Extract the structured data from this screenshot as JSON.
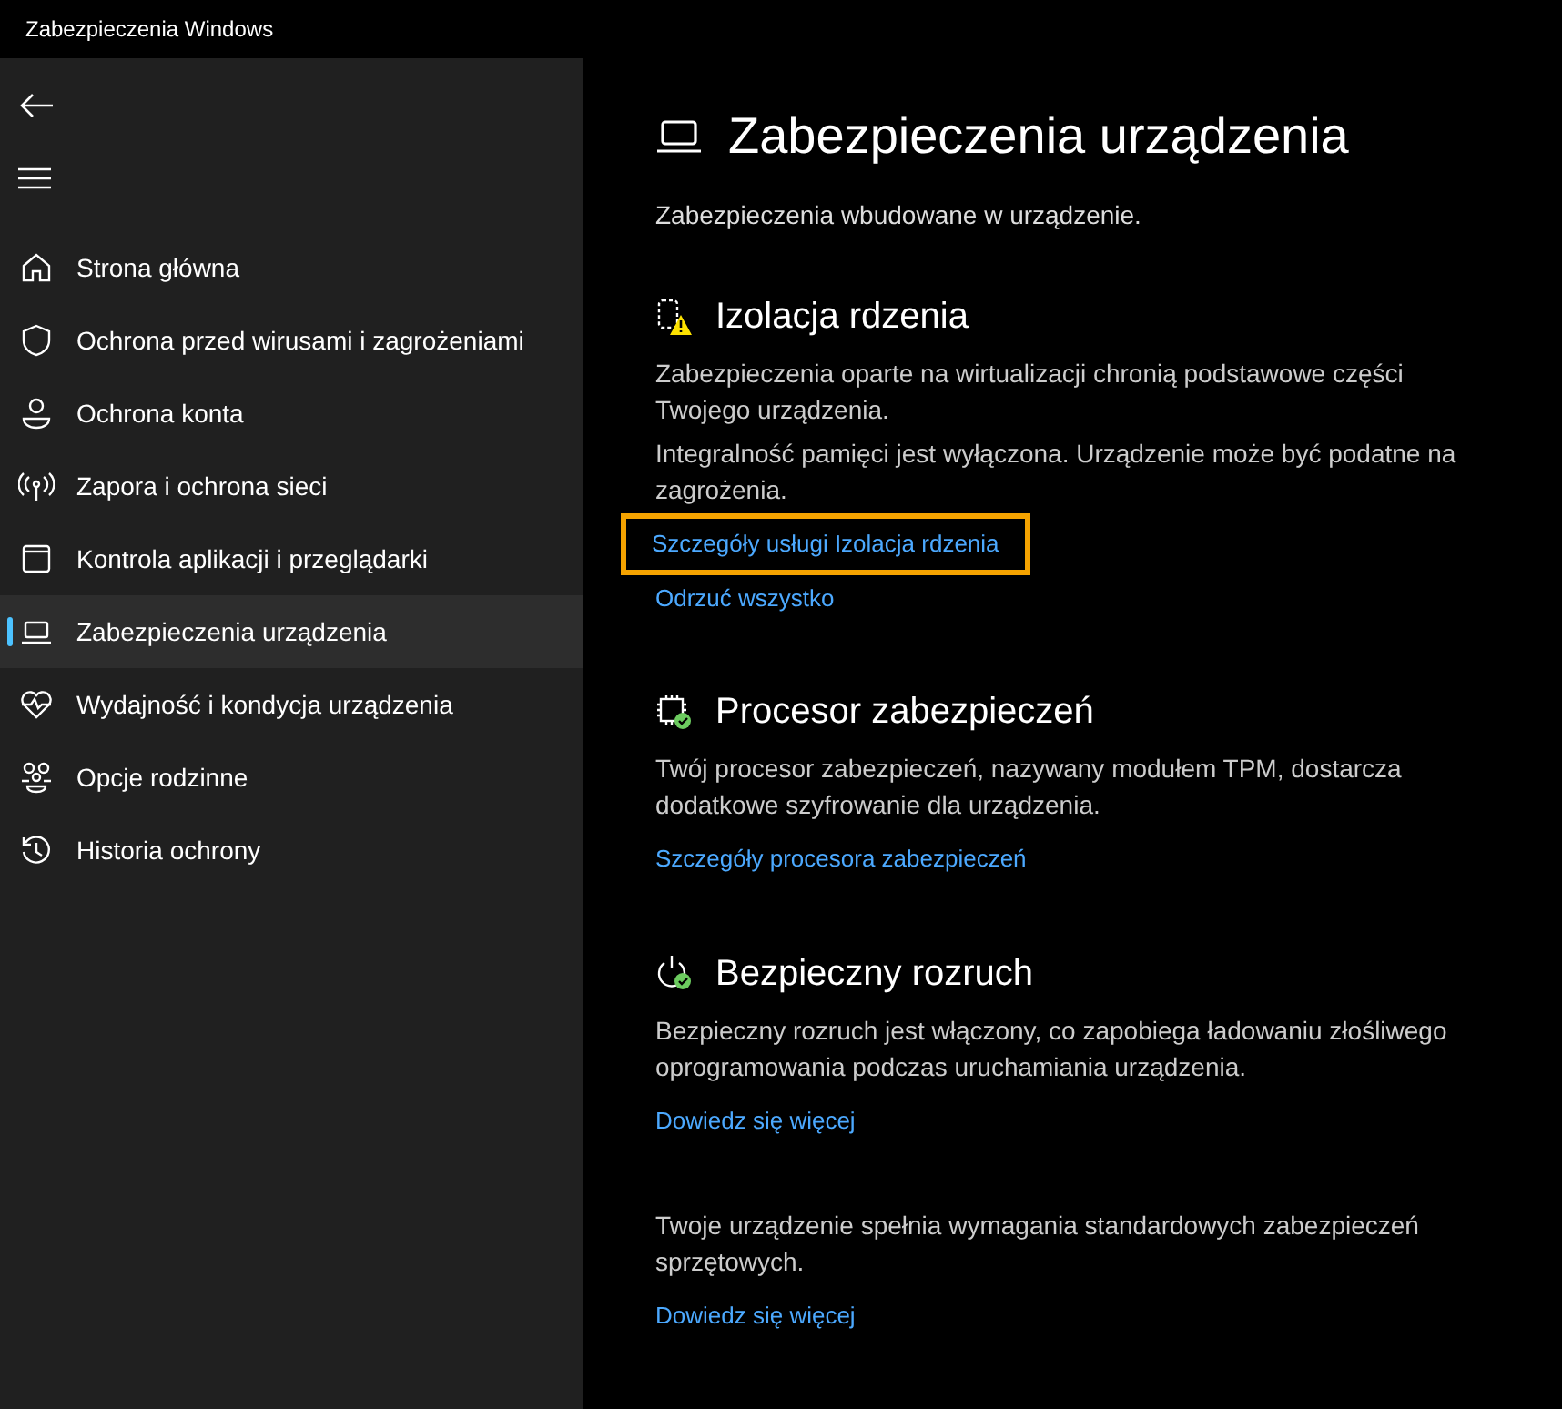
{
  "window": {
    "title": "Zabezpieczenia Windows"
  },
  "sidebar": {
    "items": [
      {
        "label": "Strona główna",
        "selected": false
      },
      {
        "label": "Ochrona przed wirusami i zagrożeniami",
        "selected": false
      },
      {
        "label": "Ochrona konta",
        "selected": false
      },
      {
        "label": "Zapora i ochrona sieci",
        "selected": false
      },
      {
        "label": "Kontrola aplikacji i przeglądarki",
        "selected": false
      },
      {
        "label": "Zabezpieczenia urządzenia",
        "selected": true
      },
      {
        "label": "Wydajność i kondycja urządzenia",
        "selected": false
      },
      {
        "label": "Opcje rodzinne",
        "selected": false
      },
      {
        "label": "Historia ochrony",
        "selected": false
      }
    ]
  },
  "page": {
    "title": "Zabezpieczenia urządzenia",
    "subtitle": "Zabezpieczenia wbudowane w urządzenie."
  },
  "sections": [
    {
      "kind": "core",
      "heading": "Izolacja rdzenia",
      "texts": [
        "Zabezpieczenia oparte na wirtualizacji chronią podstawowe części Twojego urządzenia.",
        "Integralność pamięci jest wyłączona. Urządzenie może być podatne na zagrożenia."
      ],
      "links": [
        {
          "label": "Szczegóły usługi Izolacja rdzenia",
          "focused": true
        },
        {
          "label": "Odrzuć wszystko",
          "focused": false
        }
      ]
    },
    {
      "kind": "processor",
      "heading": "Procesor zabezpieczeń",
      "texts": [
        "Twój procesor zabezpieczeń, nazywany modułem TPM, dostarcza dodatkowe szyfrowanie dla urządzenia."
      ],
      "links": [
        {
          "label": "Szczegóły procesora zabezpieczeń",
          "focused": false
        }
      ]
    },
    {
      "kind": "boot",
      "heading": "Bezpieczny rozruch",
      "texts": [
        "Bezpieczny rozruch jest włączony, co zapobiega ładowaniu złośliwego oprogramowania podczas uruchamiania urządzenia."
      ],
      "links": [
        {
          "label": "Dowiedz się więcej",
          "focused": false
        }
      ]
    },
    {
      "kind": "plain",
      "texts": [
        "Twoje urządzenie spełnia wymagania standardowych zabezpieczeń sprzętowych."
      ],
      "links": [
        {
          "label": "Dowiedz się więcej",
          "focused": false
        }
      ]
    }
  ]
}
